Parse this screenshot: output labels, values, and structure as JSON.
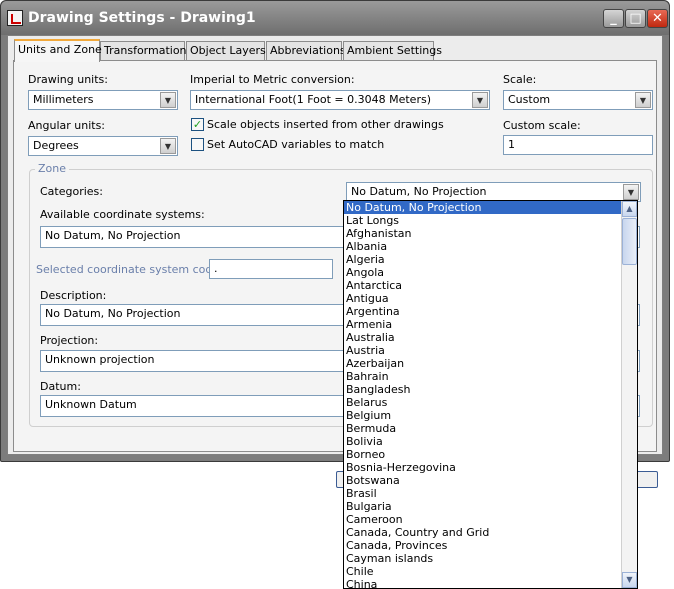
{
  "window": {
    "title": "Drawing Settings - Drawing1",
    "minimize_glyph": "_",
    "maximize_glyph": "□",
    "close_glyph": "✕"
  },
  "tabs": [
    {
      "label": "Units and Zone",
      "active": true
    },
    {
      "label": "Transformation"
    },
    {
      "label": "Object Layers"
    },
    {
      "label": "Abbreviations"
    },
    {
      "label": "Ambient Settings"
    }
  ],
  "units": {
    "drawing_units_label": "Drawing units:",
    "drawing_units_value": "Millimeters",
    "conversion_label": "Imperial to Metric conversion:",
    "conversion_value": "International Foot(1 Foot = 0.3048 Meters)",
    "scale_label": "Scale:",
    "scale_value": "Custom",
    "angular_units_label": "Angular units:",
    "angular_units_value": "Degrees",
    "scale_objects_label": "Scale objects inserted from other drawings",
    "scale_objects_checked": true,
    "set_autocad_label": "Set AutoCAD variables to match",
    "set_autocad_checked": false,
    "custom_scale_label": "Custom scale:",
    "custom_scale_value": "1"
  },
  "zone": {
    "group_title": "Zone",
    "categories_label": "Categories:",
    "categories_value": "No Datum, No Projection",
    "available_label": "Available coordinate systems:",
    "available_value": "No Datum, No Projection",
    "selected_code_label": "Selected coordinate system code:",
    "selected_code_value": ".",
    "description_label": "Description:",
    "description_value": "No Datum, No Projection",
    "projection_label": "Projection:",
    "projection_value": "Unknown projection",
    "datum_label": "Datum:",
    "datum_value": "Unknown Datum"
  },
  "dropdown": {
    "selected": "No Datum, No Projection",
    "items": [
      "No Datum, No Projection",
      "Lat Longs",
      "Afghanistan",
      "Albania",
      "Algeria",
      "Angola",
      "Antarctica",
      "Antigua",
      "Argentina",
      "Armenia",
      "Australia",
      "Austria",
      "Azerbaijan",
      "Bahrain",
      "Bangladesh",
      "Belarus",
      "Belgium",
      "Bermuda",
      "Bolivia",
      "Borneo",
      "Bosnia-Herzegovina",
      "Botswana",
      "Brasil",
      "Bulgaria",
      "Cameroon",
      "Canada, Country and Grid",
      "Canada, Provinces",
      "Cayman islands",
      "Chile",
      "China"
    ]
  },
  "icons": {
    "combo_arrow": "▼",
    "scroll_up": "▲",
    "scroll_down": "▼",
    "check": "✓"
  }
}
